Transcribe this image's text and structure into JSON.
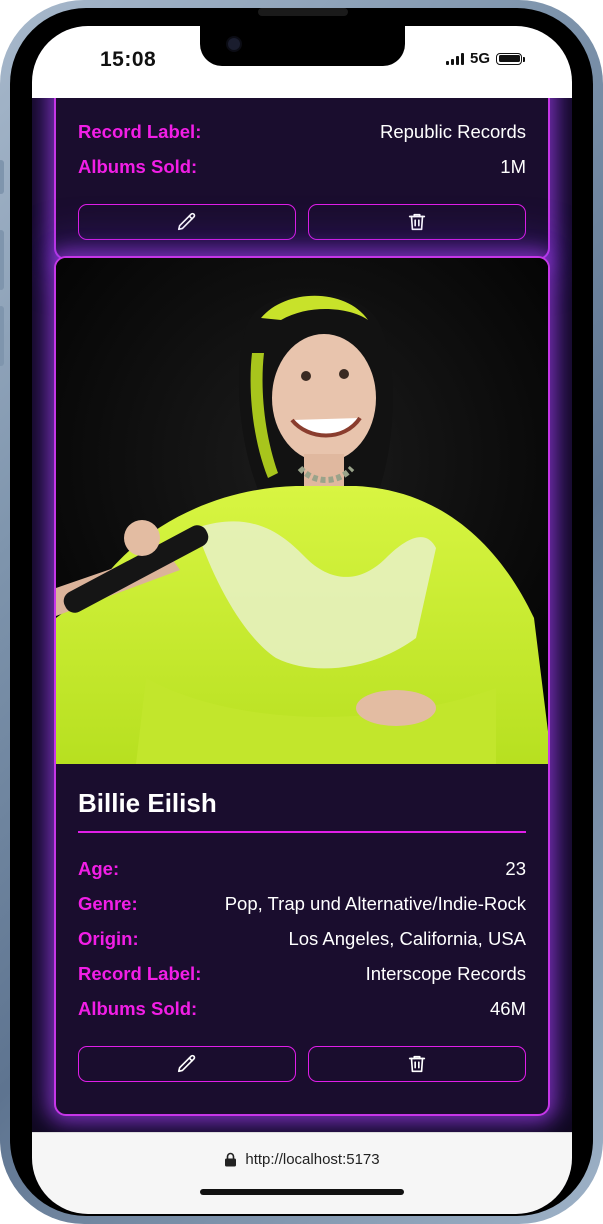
{
  "status_bar": {
    "time": "15:08",
    "network": "5G"
  },
  "cards": [
    {
      "name": "",
      "details": [
        {
          "label": "Record Label:",
          "value": "Republic Records"
        },
        {
          "label": "Albums Sold:",
          "value": "1M"
        }
      ],
      "edit_icon": "pencil-icon",
      "delete_icon": "trash-icon"
    },
    {
      "name": "Billie Eilish",
      "photo_alt": "Billie Eilish performing on stage in a neon green outfit",
      "details": [
        {
          "label": "Age:",
          "value": "23"
        },
        {
          "label": "Genre:",
          "value": "Pop, Trap und Alternative/Indie-Rock"
        },
        {
          "label": "Origin:",
          "value": "Los Angeles, California, USA"
        },
        {
          "label": "Record Label:",
          "value": "Interscope Records"
        },
        {
          "label": "Albums Sold:",
          "value": "46M"
        }
      ],
      "edit_icon": "pencil-icon",
      "delete_icon": "trash-icon"
    }
  ],
  "browser": {
    "url": "http://localhost:5173",
    "lock_icon": "lock-icon"
  },
  "colors": {
    "accent": "#f21ee6",
    "card_bg": "#1a0d2e",
    "glow": "#b446ff"
  }
}
